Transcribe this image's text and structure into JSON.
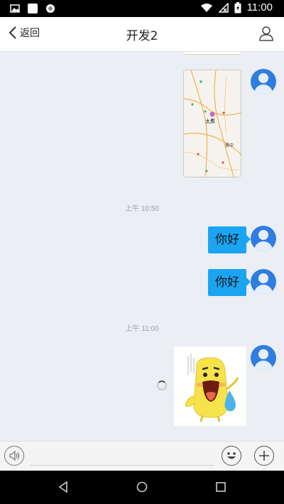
{
  "status_bar": {
    "time": "11:00"
  },
  "header": {
    "back_label": "返回",
    "title": "开发2"
  },
  "messages": {
    "map_labels": [
      "太原",
      "晋中"
    ],
    "time_1": "上午 10:50",
    "text_1": "你好",
    "text_2": "你好",
    "time_2": "上午 11:00"
  },
  "colors": {
    "bubble": "#1aa5f2",
    "avatar": "#2f7de1"
  }
}
